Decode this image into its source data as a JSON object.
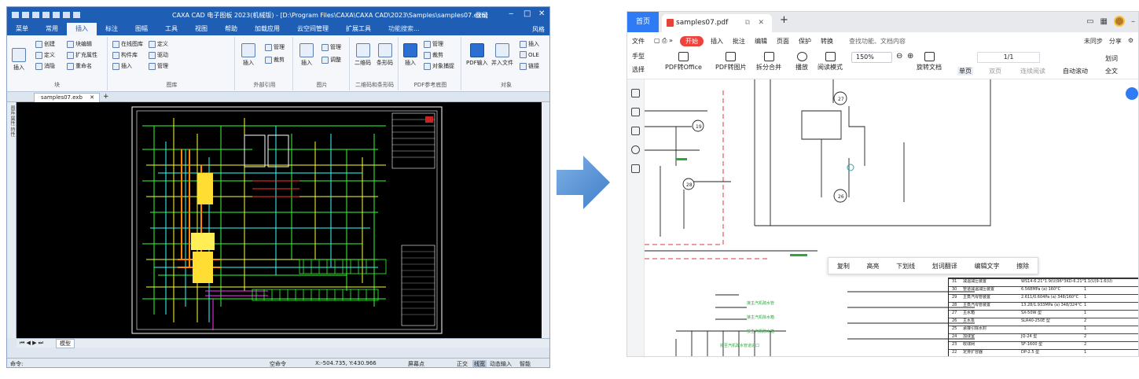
{
  "cad": {
    "title": "CAXA CAD 电子图板 2023(机械版) - [D:\\Program Files\\CAXA\\CAXA CAD\\2023\\Samples\\samples07.exb]",
    "login": "登录",
    "window_controls": [
      "‒",
      "□",
      "✕"
    ],
    "menu": [
      "菜单",
      "常用",
      "插入",
      "标注",
      "图幅",
      "工具",
      "视图",
      "帮助",
      "加载应用",
      "云空间管理",
      "扩展工具"
    ],
    "menu_active": "插入",
    "help_search": "功能搜索...",
    "style_label": "风格",
    "ribbon": {
      "block": {
        "label": "块",
        "insert": "插入",
        "create": "创建",
        "define": "定义",
        "eliminate": "消隐",
        "block_edit": "块编辑",
        "ext_attr": "扩充属性",
        "rename": "重命名"
      },
      "library": {
        "label": "图库",
        "online": "在线图库",
        "define": "定义",
        "part_lib": "构件库",
        "drive": "驱动",
        "insert": "插入",
        "manage": "管理"
      },
      "external": {
        "label": "外部引用",
        "insert": "插入",
        "manage": "管理",
        "clip": "裁剪"
      },
      "image": {
        "label": "图片",
        "insert": "插入",
        "manage": "管理",
        "adjust": "调整"
      },
      "barcode": {
        "label": "二维码和条形码",
        "qrcode": "二维码",
        "barcode": "条形码"
      },
      "pdf_ref": {
        "label": "PDF参考底图",
        "insert": "插入",
        "manage": "管理",
        "clip": "裁剪",
        "snap": "对象捕捉"
      },
      "object": {
        "label": "对象",
        "pdf_input": "PDF输入",
        "insert_file": "并入文件",
        "insert": "插入",
        "ole": "OLE",
        "link": "链接"
      }
    },
    "doc_tab": "samples07.exb",
    "sidebar_label": "图库 属性 特性",
    "model_tab": "模型",
    "status": {
      "command": "命令:",
      "empty_cmd": "空命令",
      "coords": "X:-504.735, Y:430.966",
      "screen_point": "屏幕点",
      "ortho": "正交",
      "linewidth": "线宽",
      "dyn_input": "动态输入",
      "smart": "智能"
    }
  },
  "pdf": {
    "home_tab": "首页",
    "doc_tab": "samples07.pdf",
    "menu": {
      "file": "文件",
      "start": "开始",
      "items": [
        "插入",
        "批注",
        "编辑",
        "页面",
        "保护",
        "转换"
      ],
      "search": "查找功能、文档内容",
      "sync": "未同步",
      "share": "分享"
    },
    "toolbar": {
      "hand": "手型",
      "select": "选择",
      "to_office": "PDF转Office",
      "to_image": "PDF转图片",
      "split_merge": "拆分合并",
      "play": "播放",
      "read_mode": "阅读模式",
      "zoom": "150%",
      "rotate": "旋转文档",
      "single": "单页",
      "double": "双页",
      "continuous": "连续阅读",
      "auto_scroll": "自动滚动",
      "page": "1/1",
      "word_translate": "划词",
      "full_text": "全文"
    },
    "context_menu": [
      "复制",
      "高亮",
      "下划线",
      "划词翻译",
      "编辑文字",
      "擦除"
    ],
    "bom_rows": [
      [
        "31",
        "减温减压装置",
        "WS14-6.21°1.9(U)96°3KD-6.21°1.1(U)9-1.6(U)",
        "1"
      ],
      [
        "30",
        "管道减温减压装置",
        "6.568MPa (a) 160°C",
        "1"
      ],
      [
        "29",
        "主蒸汽母管装置",
        "2.611/0.604Pa (a) 348/160°C",
        "1"
      ],
      [
        "28",
        "主蒸汽母管装置",
        "13.28/1.933MPa (a) 348/324°C",
        "1"
      ],
      [
        "27",
        "主水箱",
        "SX-50W 型",
        "1"
      ],
      [
        "26",
        "主水泵",
        "SLR40-250E 型",
        "2"
      ],
      [
        "25",
        "承接引除水封",
        "",
        "1"
      ],
      [
        "24",
        "加球室",
        "JQ-24 型",
        "2"
      ],
      [
        "23",
        "收球网",
        "SF-1600 型",
        "2"
      ],
      [
        "22",
        "定排扩容器",
        "DP-2.5 型",
        "1"
      ]
    ],
    "drawing_labels": [
      "27",
      "26",
      "28",
      "19"
    ],
    "annotation_labels": [
      "接主汽机疏水管",
      "接主汽机除水箱",
      "接主汽机除水箱",
      "接至汽机疏水管道进口"
    ]
  }
}
